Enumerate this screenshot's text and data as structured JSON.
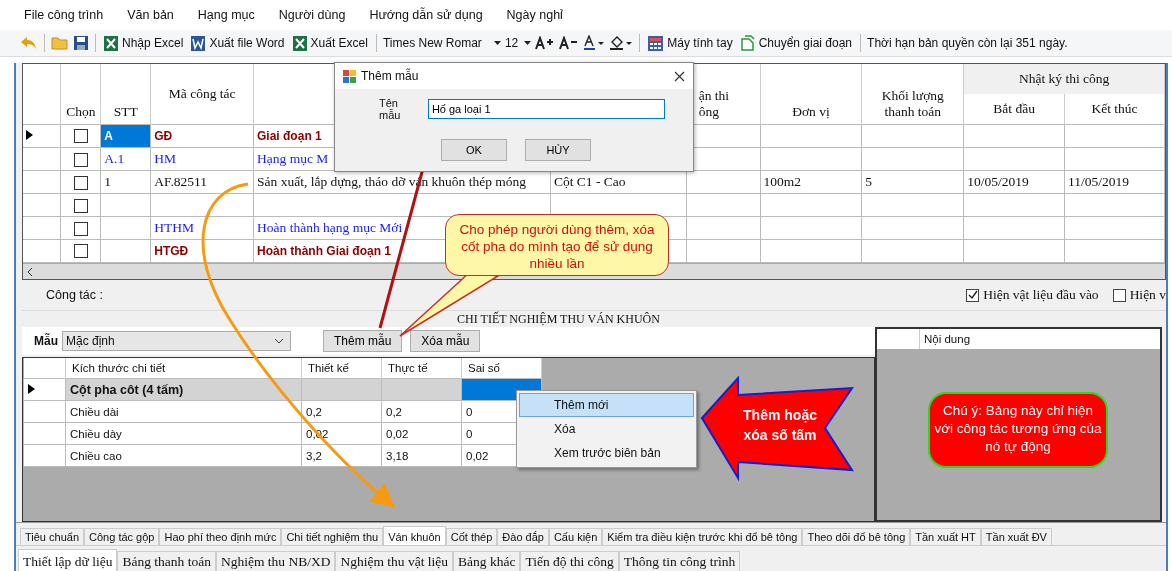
{
  "menu": [
    "File công trình",
    "Văn bản",
    "Hạng mục",
    "Người dùng",
    "Hướng dẫn sử dụng",
    "Ngày nghỉ"
  ],
  "toolbar": {
    "import_excel": "Nhập Excel",
    "export_word": "Xuất file Word",
    "export_excel": "Xuất Excel",
    "font": "Times New Romar",
    "size": "12",
    "calculator": "Máy tính tay",
    "change_phase": "Chuyển giai đoạn",
    "license": "Thời hạn bản quyền còn lại 351 ngày."
  },
  "grid": {
    "headers": {
      "select": "Chọn",
      "stt": "STT",
      "code": "Mã công tác",
      "column_6": "ận thi ông",
      "unit": "Đơn vị",
      "quantity": "Khối lượng thanh toán",
      "log": "Nhật ký thi công",
      "start": "Bắt đầu",
      "end": "Kết thúc"
    },
    "rows": [
      {
        "kind": "phase",
        "selected": true,
        "checked": false,
        "stt": "A",
        "code": "GĐ",
        "description": "Giai đoạn 1"
      },
      {
        "kind": "category",
        "selected": false,
        "checked": false,
        "stt": "A.1",
        "code": "HM",
        "description": "Hạng mục M"
      },
      {
        "kind": "task",
        "selected": false,
        "checked": false,
        "stt": "1",
        "code": "AF.82511",
        "description": "Sản xuất, lắp dựng, tháo dỡ ván khuôn thép móng",
        "column_5": "Cột C1 - Cao",
        "unit": "100m2",
        "quantity": "5",
        "start": "10/05/2019",
        "end": "11/05/2019"
      },
      {
        "kind": "task",
        "selected": false,
        "checked": false
      },
      {
        "kind": "category",
        "selected": false,
        "checked": false,
        "code": "HTHM",
        "description": "Hoàn thành hạng mục Mới"
      },
      {
        "kind": "phase",
        "selected": false,
        "checked": false,
        "code": "HTGĐ",
        "description": "Hoàn thành Giai đoạn 1"
      }
    ]
  },
  "work_label": "Công tác :",
  "options": [
    {
      "label": "Hiện vật liệu đầu vào",
      "checked": true
    },
    {
      "label": "Hiện v",
      "checked": false
    }
  ],
  "detail": {
    "title": "CHI TIẾT NGHIỆM THU VÁN KHUÔN",
    "template_label": "Mẫu",
    "template": "Mặc định",
    "add_template": "Thêm mẫu",
    "delete_template": "Xóa mẫu",
    "columns": [
      "Kích thước chi tiết",
      "Thiết kế",
      "Thực tế",
      "Sai số"
    ],
    "rows": [
      {
        "kind": "group",
        "selected": true,
        "label": "Cột pha côt (4 tấm)"
      },
      {
        "kind": "item",
        "selected": false,
        "label": "Chiều dài",
        "design": "0,2",
        "actual": "0,2",
        "error": "0"
      },
      {
        "kind": "item",
        "selected": false,
        "label": "Chiều dày",
        "design": "0,02",
        "actual": "0,02",
        "error": "0"
      },
      {
        "kind": "item",
        "selected": false,
        "label": "Chiều cao",
        "design": "3,2",
        "actual": "3,18",
        "error": "0,02"
      }
    ]
  },
  "content_panel": {
    "header": "Nội dung"
  },
  "context_menu": [
    {
      "label": "Thêm mới",
      "selected": true
    },
    {
      "label": "Xóa",
      "selected": false
    },
    {
      "label": "Xem trước biên bản",
      "selected": false
    }
  ],
  "dialog": {
    "title": "Thêm mẫu",
    "label": "Tên mẫu",
    "value": "Hố ga loại 1",
    "ok": "OK",
    "cancel": "HỦY"
  },
  "callouts": {
    "templates": "Cho phép người dùng thêm, xóa cốt pha do mình tạo để sử dụng nhiều lần",
    "sheets": "Thêm hoặc xóa số tấm",
    "note": "Chú ý: Bảng này chỉ hiện với công tác tương ứng của nó tự động"
  },
  "sub_tabs": [
    {
      "label": "Tiêu chuẩn",
      "selected": false
    },
    {
      "label": "Công tác gộp",
      "selected": false
    },
    {
      "label": "Hao phí theo định mức",
      "selected": false
    },
    {
      "label": "Chi tiết nghiệm thu",
      "selected": false
    },
    {
      "label": "Ván khuôn",
      "selected": true
    },
    {
      "label": "Cốt thép",
      "selected": false
    },
    {
      "label": "Đào đắp",
      "selected": false
    },
    {
      "label": "Cấu kiện",
      "selected": false
    },
    {
      "label": "Kiểm tra điều kiện trước khi đổ bê tông",
      "selected": false
    },
    {
      "label": "Theo dõi đổ bê tông",
      "selected": false
    },
    {
      "label": "Tần xuất HT",
      "selected": false
    },
    {
      "label": "Tần xuất ĐV",
      "selected": false
    }
  ],
  "main_tabs": [
    {
      "label": "Thiết lập dữ liệu",
      "selected": true
    },
    {
      "label": "Bảng thanh toán",
      "selected": false
    },
    {
      "label": "Nghiệm thu NB/XD",
      "selected": false
    },
    {
      "label": "Nghiệm thu vật liệu",
      "selected": false
    },
    {
      "label": "Bảng khác",
      "selected": false
    },
    {
      "label": "Tiến độ thi công",
      "selected": false
    },
    {
      "label": "Thông tin công trình",
      "selected": false
    }
  ]
}
